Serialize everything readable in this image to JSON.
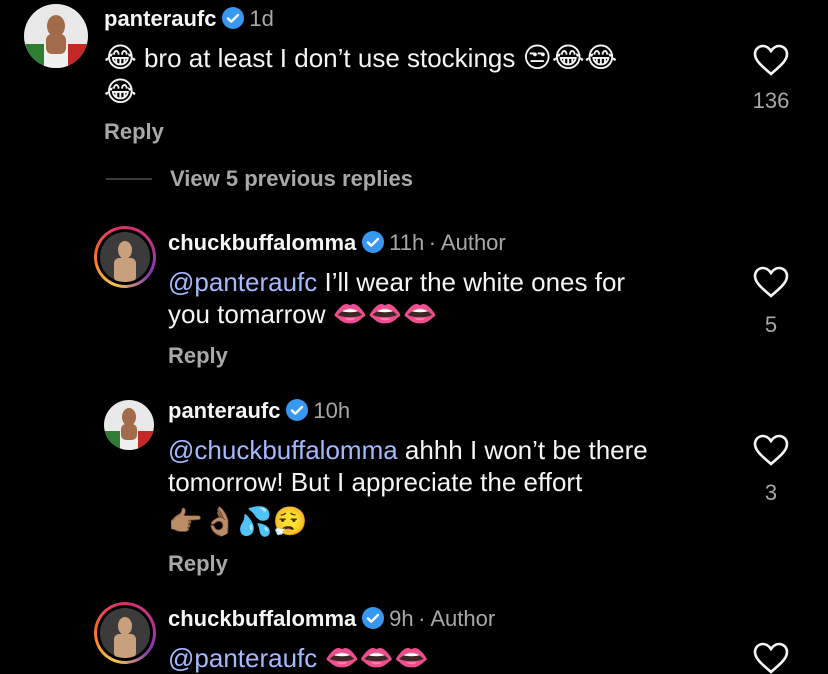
{
  "comments": [
    {
      "username": "panteraufc",
      "time": "1d",
      "text": "bro at least I don’t use stockings",
      "emoji_lead": "😂",
      "emoji_tail": "😒😂😂",
      "emoji_line2": "😂",
      "likes": "136",
      "reply_label": "Reply"
    },
    {
      "username": "chuckbuffalomma",
      "time": "11h",
      "author_tag": "· Author",
      "mention": "@panteraufc",
      "text_line1": " I’ll wear the white ones for",
      "text_line2": "you tomarrow",
      "emoji_tail": "👄👄👄",
      "likes": "5",
      "reply_label": "Reply"
    },
    {
      "username": "panteraufc",
      "time": "10h",
      "mention": "@chuckbuffalomma",
      "text_line1": " ahhh I won’t be there",
      "text_line2": "tomorrow! But I appreciate the effort",
      "emoji_line3": "👉🏽👌🏽💦😮‍💨",
      "likes": "3",
      "reply_label": "Reply"
    },
    {
      "username": "chuckbuffalomma",
      "time": "9h",
      "author_tag": "· Author",
      "mention": "@panteraufc",
      "emoji_tail": "👄👄👄"
    }
  ],
  "view_previous": "View 5 previous replies",
  "colors": {
    "background": "#000000",
    "mention": "#a6b8ff",
    "secondary": "#a8a8a8",
    "verified": "#3897f0"
  }
}
